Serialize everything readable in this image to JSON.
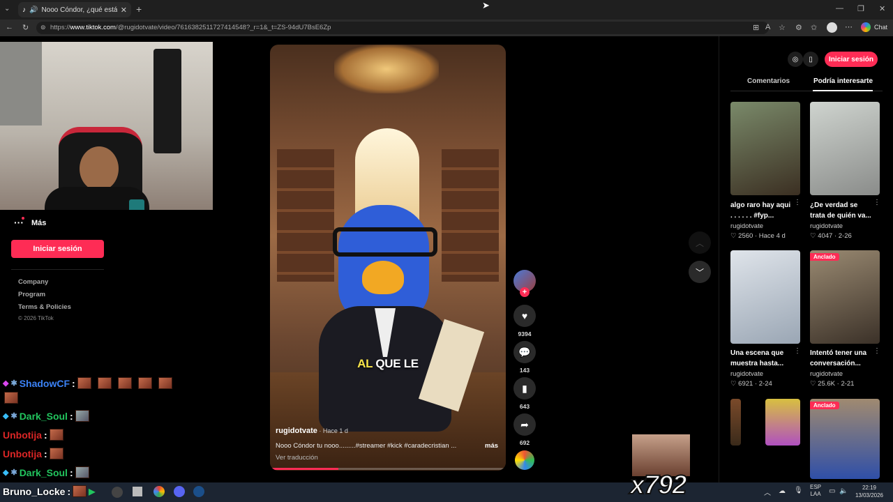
{
  "browser": {
    "tab_title": "Nooo Cóndor, ¿qué estás hac",
    "url_prefix": "https://",
    "url_domain": "www.tiktok.com",
    "url_path": "/@rugidotvate/video/7616382511727414548?_r=1&_t=ZS-94dU7BsE6Zp",
    "chat_label": "Chat"
  },
  "sidebar": {
    "more_label": "Más",
    "login_label": "Iniciar sesión",
    "links": [
      "Company",
      "Program",
      "Terms & Policies"
    ],
    "copyright": "© 2026 TikTok"
  },
  "video": {
    "caption_hl": "AL",
    "caption_rest": " QUE LE",
    "author": "rugidotvate",
    "time": " · Hace 1 d",
    "description": "Nooo Cóndor tu nooo.........#streamer #kick #caradecristian ...",
    "more_label": "más",
    "translate_label": "Ver traducción",
    "likes": "9394",
    "comments": "143",
    "saves": "643",
    "shares": "692",
    "progress": 0.29
  },
  "right_panel": {
    "login_label": "Iniciar sesión",
    "tabs": [
      "Comentarios",
      "Podría interesarte"
    ],
    "active_tab": 1,
    "pinned_label": "Anclado",
    "cards": [
      {
        "title1": "algo raro hay aqui",
        "title2": ". . . . . . #fyp...",
        "user": "rugidotvate",
        "likes": "2560",
        "date": "Hace 4 d"
      },
      {
        "title1": "¿De verdad se",
        "title2": "trata de quién va...",
        "user": "rugidotvate",
        "likes": "4047",
        "date": "2-26"
      },
      {
        "title1": "Una escena que",
        "title2": "muestra hasta...",
        "user": "rugidotvate",
        "likes": "6921",
        "date": "2-24"
      },
      {
        "title1": "Intentó tener una",
        "title2": "conversación...",
        "user": "rugidotvate",
        "likes": "25.6K",
        "date": "2-21"
      }
    ]
  },
  "chat": [
    {
      "user": "ShadowCF",
      "color": "#3b82f6"
    },
    {
      "user": "Dark_Soul",
      "color": "#22c55e"
    },
    {
      "user": "Unbotija",
      "color": "#dc2626"
    },
    {
      "user": "Unbotija",
      "color": "#dc2626"
    },
    {
      "user": "Dark_Soul",
      "color": "#22c55e"
    },
    {
      "user": "Bruno_Locke",
      "color": "#ffffff"
    }
  ],
  "overlay": {
    "combo": "x792"
  },
  "taskbar": {
    "lang1": "ESP",
    "lang2": "LAA",
    "time": "22:19",
    "date": "13/03/2026"
  },
  "colors": {
    "brand": "#fe2c55",
    "background": "#000000"
  }
}
